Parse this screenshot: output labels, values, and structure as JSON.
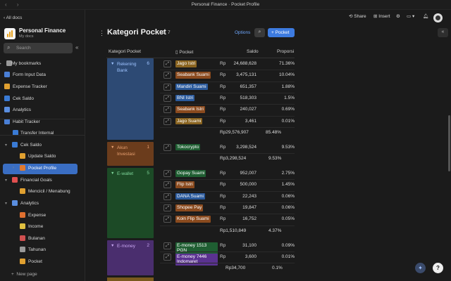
{
  "window": {
    "title": "Personal Finance · Pocket Profile",
    "nav": "‹ ›"
  },
  "sidebar": {
    "all_docs": "All docs",
    "workspace_name": "Personal Finance",
    "workspace_sub": "My docs",
    "search_placeholder": "Search",
    "items": [
      {
        "label": "My bookmarks",
        "icon": "bookmark-icon",
        "arrow": "▸"
      },
      {
        "label": "Form Input Data",
        "icon": "form-icon"
      },
      {
        "label": "Expense Tracker",
        "icon": "tracker-icon"
      },
      {
        "label": "Cek Saldo",
        "icon": "wallet-icon"
      },
      {
        "label": "Analytics",
        "icon": "chart-icon"
      },
      {
        "label": "Habit Tracker",
        "icon": "habit-icon"
      },
      {
        "label": "Transfer Internal",
        "icon": "transfer-icon"
      },
      {
        "label": "Cek Saldo",
        "icon": "wallet-icon",
        "arrow": "▾"
      },
      {
        "label": "Update Saldo",
        "icon": "refresh-icon"
      },
      {
        "label": "Pocket Profile",
        "icon": "pocket-icon",
        "arrow": "›"
      },
      {
        "label": "Financial Goals",
        "icon": "goal-icon",
        "arrow": "▾"
      },
      {
        "label": "Mencicil / Menabung",
        "icon": "savings-icon"
      },
      {
        "label": "Analytics",
        "icon": "chart-icon",
        "arrow": "▾"
      },
      {
        "label": "Expense",
        "icon": "expense-icon"
      },
      {
        "label": "Income",
        "icon": "income-icon"
      },
      {
        "label": "Bulanan",
        "icon": "calendar-icon"
      },
      {
        "label": "Tahunan",
        "icon": "calendar-icon"
      },
      {
        "label": "Pocket",
        "icon": "pocket-icon"
      }
    ],
    "new_page": "New page"
  },
  "toolbar": {
    "share": "Share",
    "insert": "Insert"
  },
  "page": {
    "title": "Kategori Pocket",
    "count": "7",
    "options": "Options",
    "add_label": "Pocket"
  },
  "table": {
    "headers": {
      "kategori": "Kategori Pocket",
      "pocket": "Pocket",
      "saldo": "Saldo",
      "proporsi": "Proporsi"
    },
    "groups": [
      {
        "name": "Rekening Bank",
        "count": "6",
        "color": "#2d4a74",
        "text_color": "#9ec3ff",
        "rows": [
          {
            "pocket": "Jago Istri",
            "tag_color": "#8a6420",
            "rp": "Rp",
            "saldo": "24,688,628",
            "proporsi": "71.36%"
          },
          {
            "pocket": "Seabank Suami",
            "tag_color": "#8a4a1e",
            "rp": "Rp",
            "saldo": "3,475,131",
            "proporsi": "10.04%"
          },
          {
            "pocket": "Mandiri Suami",
            "tag_color": "#2b5a9c",
            "rp": "Rp",
            "saldo": "651,357",
            "proporsi": "1.88%"
          },
          {
            "pocket": "BNI Istri",
            "tag_color": "#2b5a9c",
            "rp": "Rp",
            "saldo": "518,303",
            "proporsi": "1.5%"
          },
          {
            "pocket": "Seabank Istri",
            "tag_color": "#8a4a1e",
            "rp": "Rp",
            "saldo": "240,027",
            "proporsi": "0.69%"
          },
          {
            "pocket": "Jago Suami",
            "tag_color": "#8a6420",
            "rp": "Rp",
            "saldo": "3,461",
            "proporsi": "0.01%"
          }
        ],
        "total_saldo": "Rp29,576,907",
        "total_prop": "85.48%"
      },
      {
        "name": "Akun Investasi",
        "count": "1",
        "color": "#6b3c1c",
        "text_color": "#e8a070",
        "rows": [
          {
            "pocket": "Tokocrypto",
            "tag_color": "#1f5e32",
            "rp": "Rp",
            "saldo": "3,298,524",
            "proporsi": "9.53%"
          }
        ],
        "total_saldo": "Rp3,298,524",
        "total_prop": "9.53%"
      },
      {
        "name": "E-wallet",
        "count": "5",
        "color": "#1c4a26",
        "text_color": "#7fd69a",
        "rows": [
          {
            "pocket": "Gopay Suami",
            "tag_color": "#1f5e32",
            "rp": "Rp",
            "saldo": "952,007",
            "proporsi": "2.75%"
          },
          {
            "pocket": "Flip Istri",
            "tag_color": "#8a4a1e",
            "rp": "Rp",
            "saldo": "500,000",
            "proporsi": "1.45%"
          },
          {
            "pocket": "DANA Suami",
            "tag_color": "#2b5a9c",
            "rp": "Rp",
            "saldo": "22,243",
            "proporsi": "0.06%"
          },
          {
            "pocket": "Shopee Pay",
            "tag_color": "#8a4a1e",
            "rp": "Rp",
            "saldo": "19,847",
            "proporsi": "0.06%"
          },
          {
            "pocket": "Koin Flip Suami",
            "tag_color": "#8a4a1e",
            "rp": "Rp",
            "saldo": "16,752",
            "proporsi": "0.05%"
          }
        ],
        "total_saldo": "Rp1,510,849",
        "total_prop": "4.37%"
      },
      {
        "name": "E-money",
        "count": "2",
        "color": "#4a2e6e",
        "text_color": "#c9a6f2",
        "rows": [
          {
            "pocket": "E-money 1513 PGN",
            "tag_color": "#1f5e32",
            "rp": "Rp",
            "saldo": "31,100",
            "proporsi": "0.09%"
          },
          {
            "pocket": "E-money 7446 Indomaret",
            "tag_color": "#5a3290",
            "rp": "Rp",
            "saldo": "3,600",
            "proporsi": "0.01%"
          }
        ],
        "total_saldo": "Rp34,700",
        "total_prop": "0.1%"
      }
    ]
  }
}
